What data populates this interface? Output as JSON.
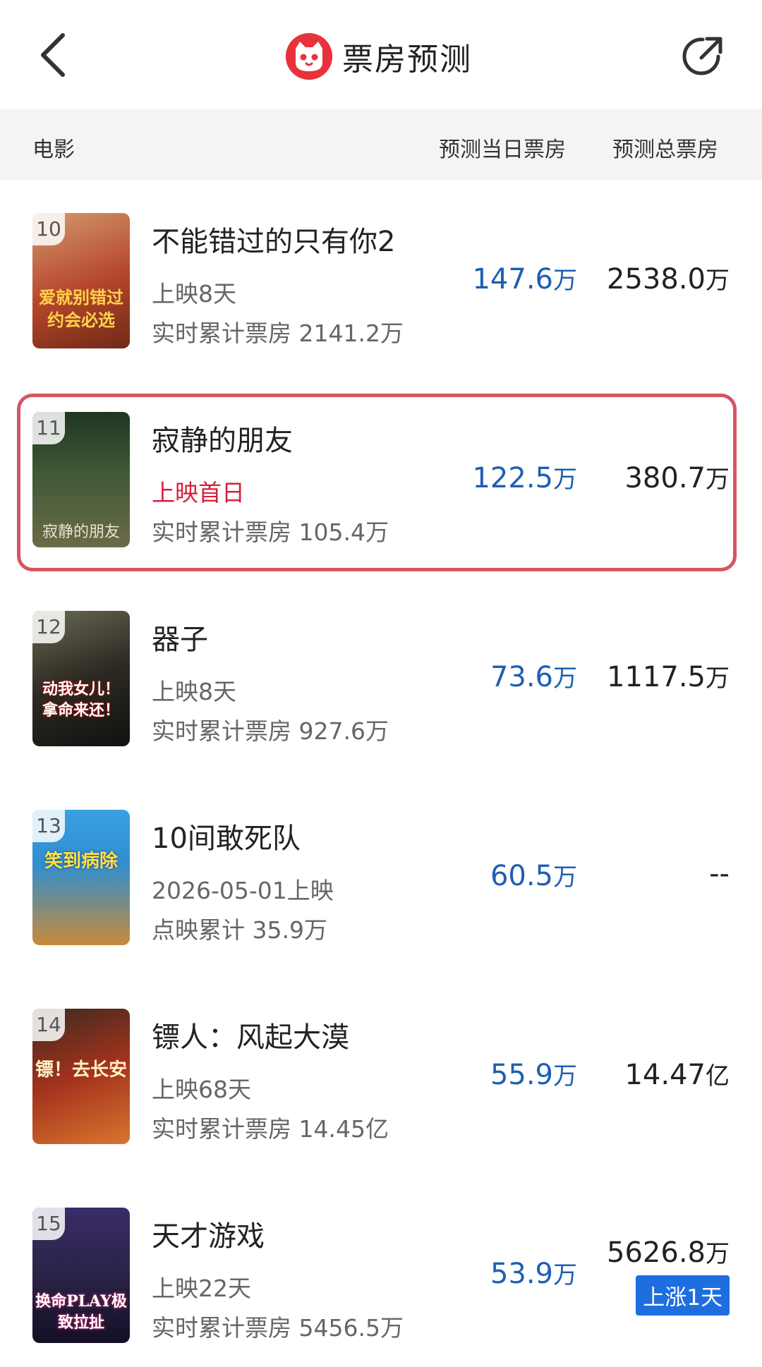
{
  "header": {
    "title": "票房预测",
    "back_icon": "chevron-left-icon",
    "share_icon": "share-icon",
    "logo_icon": "cat-logo-icon",
    "brand_color": "#e8323c"
  },
  "columns": {
    "movie": "电影",
    "day": "预测当日票房",
    "total": "预测总票房"
  },
  "rows": [
    {
      "rank": "10",
      "name": "不能错过的只有你2",
      "meta1": "上映8天",
      "meta2": "实时累计票房 2141.2万",
      "day_num": "147.6",
      "day_unit": "万",
      "total_num": "2538.0",
      "total_unit": "万",
      "poster_text": "爱就别错过约会必选",
      "poster_bg": "#b5452a"
    },
    {
      "rank": "11",
      "name": "寂静的朋友",
      "meta1": "上映首日",
      "meta2": "实时累计票房 105.4万",
      "day_num": "122.5",
      "day_unit": "万",
      "total_num": "380.7",
      "total_unit": "万",
      "poster_text": "寂静的朋友",
      "poster_bg": "#3f5a35",
      "highlight": true
    },
    {
      "rank": "12",
      "name": "器子",
      "meta1": "上映8天",
      "meta2": "实时累计票房 927.6万",
      "day_num": "73.6",
      "day_unit": "万",
      "total_num": "1117.5",
      "total_unit": "万",
      "poster_text": "动我女儿！拿命来还！",
      "poster_bg": "#2c2a22"
    },
    {
      "rank": "13",
      "name": "10间敢死队",
      "meta1": "2026-05-01上映",
      "meta2": "点映累计 35.9万",
      "day_num": "60.5",
      "day_unit": "万",
      "total_num": "--",
      "total_unit": "",
      "poster_text": "笑到病除",
      "poster_bg": "#2f8fd0"
    },
    {
      "rank": "14",
      "name": "镖人：风起大漠",
      "meta1": "上映68天",
      "meta2": "实时累计票房 14.45亿",
      "day_num": "55.9",
      "day_unit": "万",
      "total_num": "14.47",
      "total_unit": "亿",
      "poster_text": "镖！去长安",
      "poster_bg": "#a4321d"
    },
    {
      "rank": "15",
      "name": "天才游戏",
      "meta1": "上映22天",
      "meta2": "实时累计票房 5456.5万",
      "day_num": "53.9",
      "day_unit": "万",
      "total_num": "5626.8",
      "total_unit": "万",
      "badge": "上涨1天",
      "poster_text": "换命PLAY极致拉扯",
      "poster_bg": "#2a2346"
    }
  ],
  "colors": {
    "day_value": "#1e5fb3",
    "highlight_border": "#d65563",
    "first_day_text": "#d8203a",
    "badge_bg": "#1e6ee0"
  }
}
